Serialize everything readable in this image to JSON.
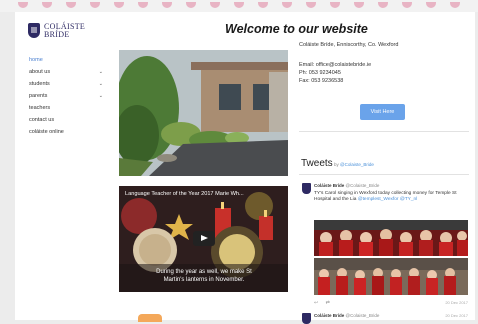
{
  "brand": {
    "name_line1": "COLÁISTE",
    "name_line2": "BRÍDE"
  },
  "nav": {
    "items": [
      {
        "label": "home",
        "active": true,
        "has_submenu": false
      },
      {
        "label": "about us",
        "active": false,
        "has_submenu": true
      },
      {
        "label": "students",
        "active": false,
        "has_submenu": true
      },
      {
        "label": "parents",
        "active": false,
        "has_submenu": true
      },
      {
        "label": "teachers",
        "active": false,
        "has_submenu": false
      },
      {
        "label": "contact us",
        "active": false,
        "has_submenu": false
      },
      {
        "label": "coláiste online",
        "active": false,
        "has_submenu": false
      }
    ]
  },
  "header": {
    "title": "Welcome to our website"
  },
  "video": {
    "title": "Language Teacher of the Year 2017 Marie Wh...",
    "caption": "During the year as well, we make St Martin's lanterns in November."
  },
  "contact": {
    "address": "Coláiste Bríde, Enniscorthy, Co. Wexford",
    "email": "Email: office@colaistebride.ie",
    "phone": "Ph: 053 9234045",
    "fax": "Fax: 053 9236538",
    "visit_button": "Visit Here"
  },
  "tweets": {
    "heading": "Tweets",
    "by_prefix": "by",
    "by_handle": "@Colaiste_Bride",
    "items": [
      {
        "name": "Coláiste Bríde",
        "handle": "@Colaiste_Bride",
        "text": "TY's Carol singing in Wexford today collecting money for Temple St Hospital and the Lia ",
        "link_text": "@templest_Wexfor @TY_nl",
        "time": "20 Dec 2017"
      },
      {
        "name": "Coláiste Bríde",
        "handle": "@Colaiste_Bride",
        "time": "20 Dec 2017"
      }
    ]
  }
}
